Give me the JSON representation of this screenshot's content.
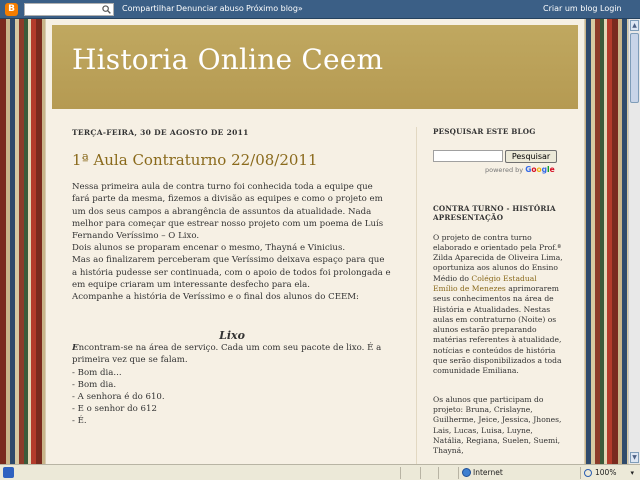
{
  "navbar": {
    "logo_letter": "B",
    "search_value": "",
    "links": [
      "Compartilhar",
      "Denunciar abuso",
      "Próximo blog»"
    ],
    "right_links": [
      "Criar um blog",
      "Login"
    ]
  },
  "header": {
    "title": "Historia Online Ceem"
  },
  "post": {
    "date": "TERÇA-FEIRA, 30 DE AGOSTO DE 2011",
    "title": "1ª Aula Contraturno 22/08/2011",
    "paragraphs": [
      "Nessa primeira aula de contra turno foi conhecida toda a equipe que fará parte da mesma, fizemos a divisão as equipes e como o projeto em um dos seus campos a abrangência de assuntos da atualidade. Nada melhor para começar que estrear nosso projeto com um poema de Luís Fernando Veríssimo – O Lixo.",
      "Dois alunos se proparam  encenar o mesmo, Thayná e Vinicius.",
      "Mas ao finalizarem perceberam que Veríssimo deixava espaço para que a história pudesse ser continuada, com o apoio de todos foi prolongada e em equipe criaram um interessante desfecho para ela.",
      "Acompanhe a história de Veríssimo e o final dos alunos do CEEM:"
    ],
    "poem_title": "Lixo",
    "poem_first_letter": "E",
    "poem_lines": [
      "ncontram-se na área de serviço. Cada um com seu pacote de lixo. É a primeira vez que se falam.",
      "- Bom dia...",
      "- Bom dia.",
      "- A senhora é do 610.",
      "- E o senhor do 612",
      "- É."
    ]
  },
  "sidebar": {
    "search_heading": "PESQUISAR ESTE BLOG",
    "search_button": "Pesquisar",
    "powered_by": "powered by",
    "google": [
      "G",
      "o",
      "o",
      "g",
      "l",
      "e"
    ],
    "section2_heading": "CONTRA TURNO - HISTÓRIA APRESENTAÇÃO",
    "section2_text_before_link": "O projeto de contra turno elaborado e orientado pela Prof.ª Zilda Aparecida de Oliveira Lima, oportuniza aos alunos do Ensino Médio do ",
    "section2_link": "Colégio Estadual Emílio de Menezes",
    "section2_text_after_link": " aprimorarem seus conhecimentos na área de História e Atualidades. Nestas aulas em contraturno (Noite) os alunos estarão preparando matérias referentes à atualidade, notícias e conteúdos de história que serão disponibilizados a toda comunidade Emiliana.",
    "section3_text": "Os alunos que participam do projeto: Bruna, Crislayne, Guilherme, Jeice, Jessica, Jhones, Lais, Lucas, Luisa, Luyne, Natália, Regiana, Suelen, Suemi, Thayná,"
  },
  "statusbar": {
    "zone": "Internet",
    "zoom": "100%"
  }
}
